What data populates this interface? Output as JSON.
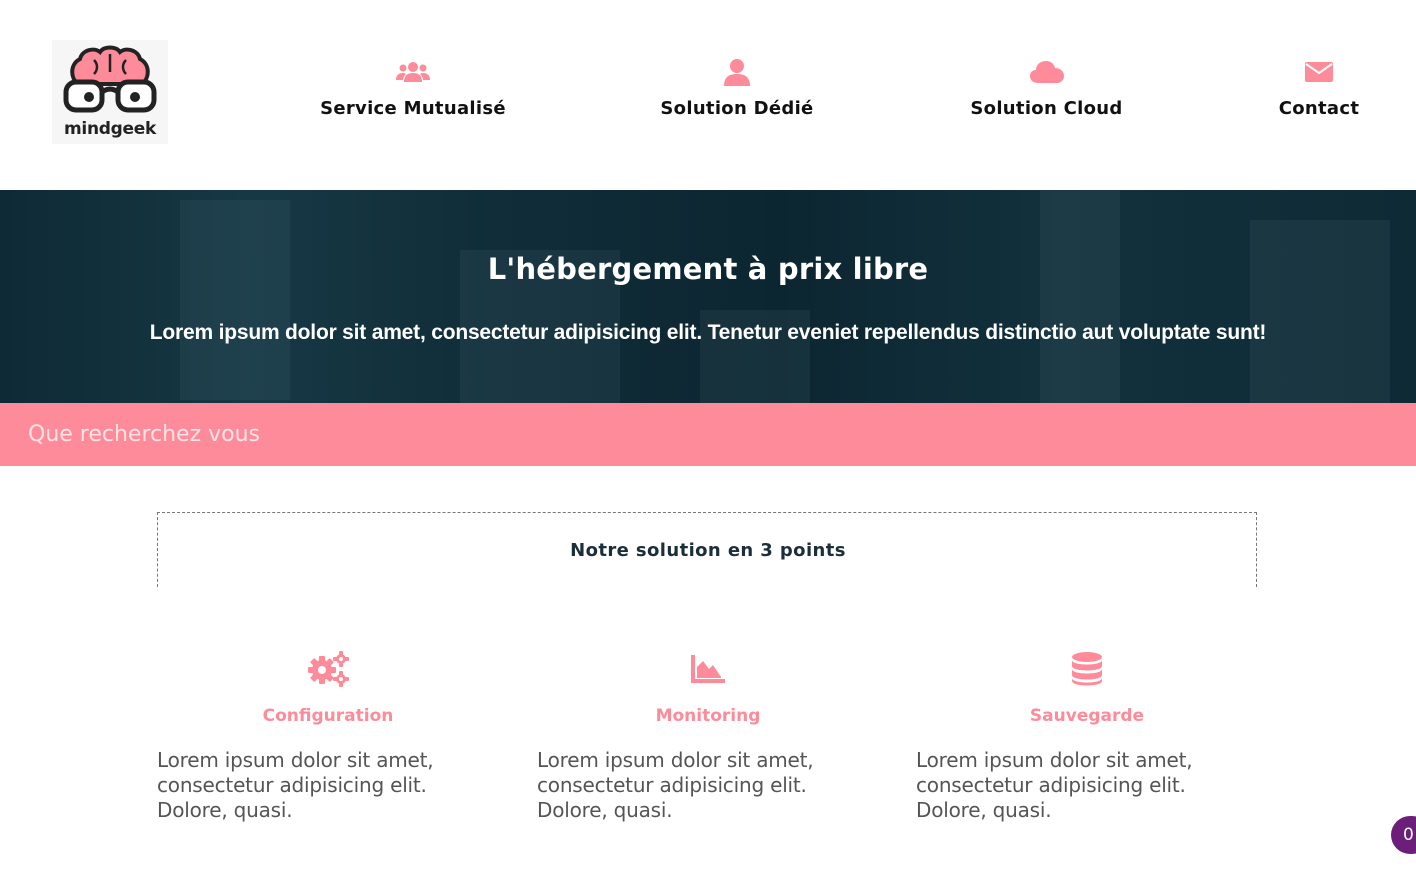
{
  "header": {
    "logo_text": "mindgeek",
    "nav": [
      {
        "label": "Service Mutualisé",
        "icon": "users-icon"
      },
      {
        "label": "Solution Dédié",
        "icon": "user-icon"
      },
      {
        "label": "Solution Cloud",
        "icon": "cloud-icon"
      },
      {
        "label": "Contact",
        "icon": "envelope-icon"
      }
    ]
  },
  "hero": {
    "title": "L'hébergement à prix libre",
    "subtitle": "Lorem ipsum dolor sit amet, consectetur adipisicing elit. Tenetur eveniet repellendus distinctio aut voluptate sunt!"
  },
  "search": {
    "placeholder": "Que recherchez vous",
    "value": ""
  },
  "solution": {
    "title": "Notre solution en 3 points"
  },
  "features": [
    {
      "title": "Configuration",
      "icon": "cogs-icon",
      "text": "Lorem ipsum dolor sit amet, consectetur adipisicing elit. Dolore, quasi."
    },
    {
      "title": "Monitoring",
      "icon": "area-chart-icon",
      "text": "Lorem ipsum dolor sit amet, consectetur adipisicing elit. Dolore, quasi."
    },
    {
      "title": "Sauvegarde",
      "icon": "database-icon",
      "text": "Lorem ipsum dolor sit amet, consectetur adipisicing elit. Dolore, quasi."
    }
  ],
  "badge": {
    "count": "0"
  },
  "colors": {
    "accent": "#fe8b99",
    "hero_bg": "#0e2a36",
    "badge": "#6b1f7a"
  }
}
